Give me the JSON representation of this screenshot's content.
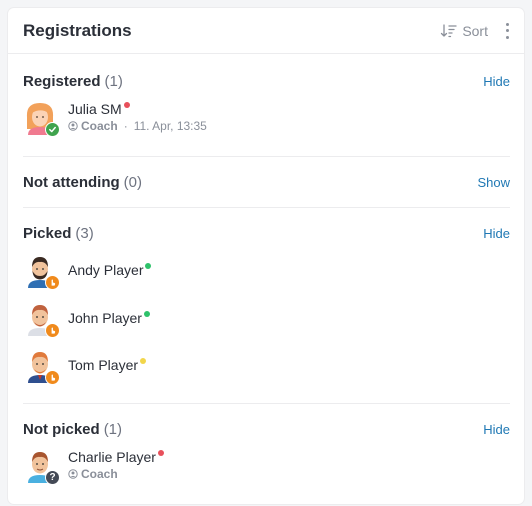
{
  "header": {
    "title": "Registrations",
    "sort_label": "Sort"
  },
  "sections": {
    "registered": {
      "label": "Registered",
      "count": "(1)",
      "action": "Hide",
      "people": [
        {
          "name": "Julia SM",
          "role": "Coach",
          "date": "11. Apr, 13:35",
          "status_color": "#e8505b",
          "badge": "check"
        }
      ]
    },
    "not_attending": {
      "label": "Not attending",
      "count": "(0)",
      "action": "Show"
    },
    "picked": {
      "label": "Picked",
      "count": "(3)",
      "action": "Hide",
      "people": [
        {
          "name": "Andy Player",
          "status_color": "#2ec26a",
          "badge": "hand"
        },
        {
          "name": "John Player",
          "status_color": "#2ec26a",
          "badge": "hand"
        },
        {
          "name": "Tom Player",
          "status_color": "#f2d64b",
          "badge": "hand"
        }
      ]
    },
    "not_picked": {
      "label": "Not picked",
      "count": "(1)",
      "action": "Hide",
      "people": [
        {
          "name": "Charlie Player",
          "role": "Coach",
          "status_color": "#e8505b",
          "badge": "question"
        }
      ]
    }
  },
  "colors": {
    "link": "#1f78b4",
    "text": "#2b2f38",
    "muted": "#8a8f99"
  }
}
